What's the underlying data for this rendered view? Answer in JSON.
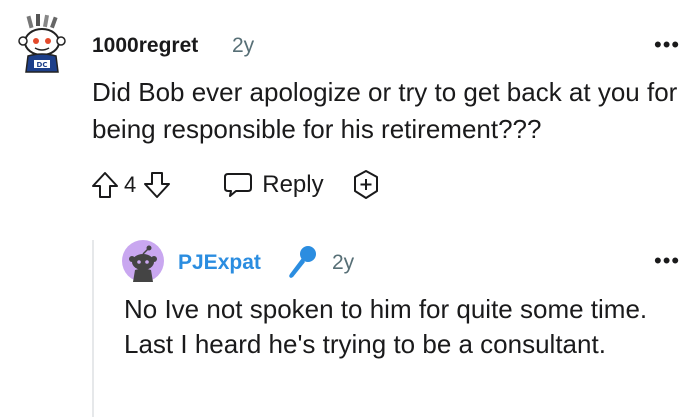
{
  "comment": {
    "username": "1000regret",
    "time": "2y",
    "more_label": "•••",
    "body": "Did Bob ever apologize or try to get back at you for being responsible for his retirement???",
    "vote_count": "4",
    "reply_label": "Reply",
    "avatar_icon": "snoo-avatar-icon"
  },
  "reply": {
    "username": "PJExpat",
    "time": "2y",
    "more_label": "•••",
    "body": "No Ive not spoken to him for quite some time. Last I heard he's trying to be a consultant.",
    "flair_icon": "microphone-icon",
    "avatar_icon": "snoo-avatar-icon"
  },
  "colors": {
    "text": "#1a1a1b",
    "meta": "#576f76",
    "username_link": "#2b8de0",
    "avatar_bg": "#c9a7f0",
    "thread_line": "#e6e8ea"
  }
}
